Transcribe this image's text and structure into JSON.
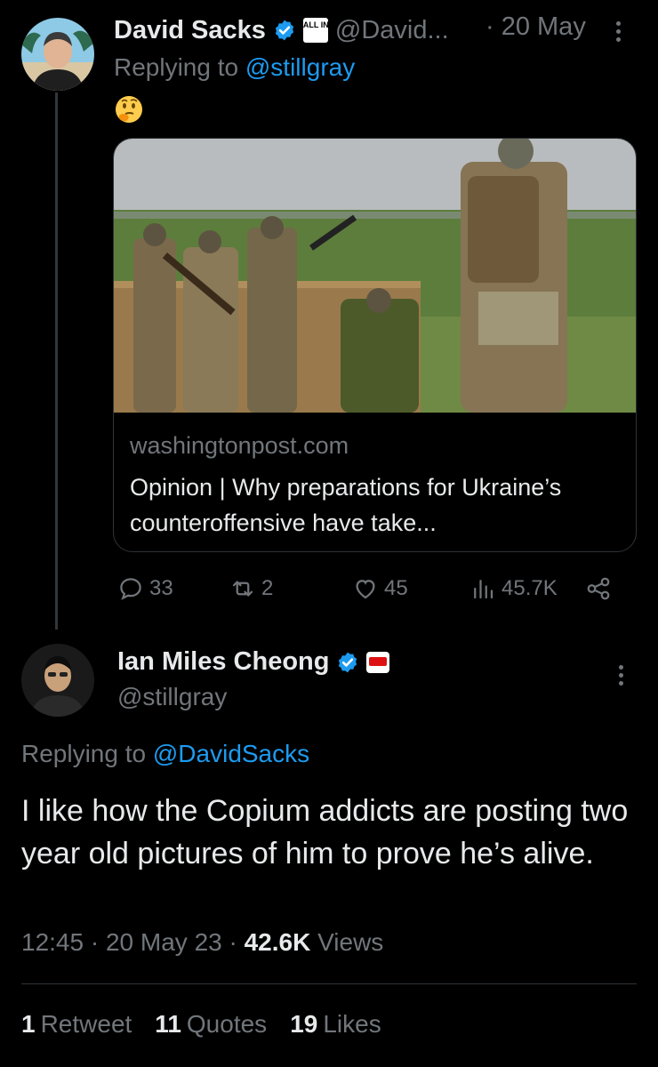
{
  "tweet1": {
    "name": "David Sacks",
    "badge_text": "ALL IN",
    "handle": "@David...",
    "date": "· 20 May",
    "replying_prefix": "Replying to",
    "replying_handle": "@stillgray",
    "emoji": "🤔",
    "card": {
      "domain": "washingtonpost.com",
      "title": "Opinion | Why preparations for Ukraine’s counteroffensive have take..."
    },
    "actions": {
      "replies": "33",
      "retweets": "2",
      "likes": "45",
      "views": "45.7K"
    }
  },
  "tweet2": {
    "name": "Ian Miles Cheong",
    "handle": "@stillgray",
    "replying_prefix": "Replying to",
    "replying_handle": "@DavidSacks",
    "text": "I like how the Copium addicts are posting two year old pictures of him to prove he’s alive.",
    "time": "12:45",
    "date": "20 May 23",
    "views_count": "42.6K",
    "views_label": "Views",
    "retweets_count": "1",
    "retweets_label": "Retweet",
    "quotes_count": "11",
    "quotes_label": "Quotes",
    "likes_count": "19",
    "likes_label": "Likes"
  },
  "colors": {
    "background": "#000000",
    "text": "#e7e9ea",
    "muted": "#71767b",
    "link": "#1d9bf0",
    "verified": "#1d9bf0",
    "border": "#2f3336"
  },
  "icons": [
    "verified-icon",
    "reply-icon",
    "retweet-icon",
    "like-icon",
    "views-icon",
    "share-icon",
    "more-icon"
  ]
}
